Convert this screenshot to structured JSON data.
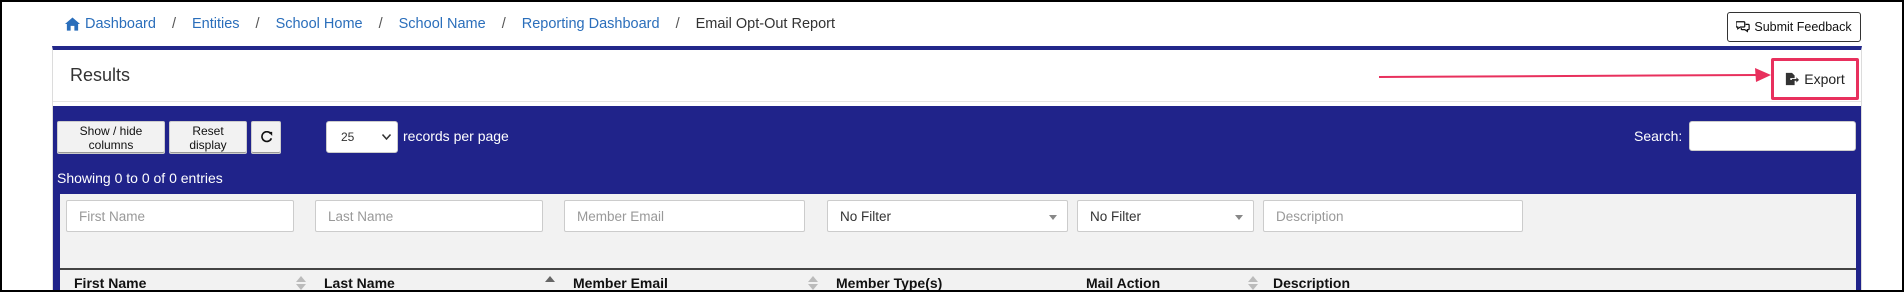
{
  "breadcrumb": {
    "items": [
      "Dashboard",
      "Entities",
      "School Home",
      "School Name",
      "Reporting Dashboard"
    ],
    "current": "Email Opt-Out Report",
    "separator": "/"
  },
  "feedback": {
    "label": "Submit Feedback"
  },
  "panel": {
    "title": "Results",
    "export_label": "Export"
  },
  "toolbar": {
    "show_hide": "Show / hide columns",
    "reset": "Reset display",
    "page_size": "25",
    "records_per_page": "records per page",
    "search_label": "Search:",
    "search_value": ""
  },
  "info": "Showing 0 to 0 of 0 entries",
  "filters": {
    "first_name": "First Name",
    "last_name": "Last Name",
    "member_email": "Member Email",
    "member_type": "No Filter",
    "mail_action": "No Filter",
    "description": "Description"
  },
  "columns": [
    "First Name",
    "Last Name",
    "Member Email",
    "Member Type(s)",
    "Mail Action",
    "Description"
  ],
  "colors": {
    "accent": "#22278a",
    "highlight": "#e8305d",
    "link": "#2a6ebb"
  },
  "icons": {
    "home": "home-icon",
    "feedback": "comments-icon",
    "export": "file-export-icon",
    "refresh": "refresh-icon"
  }
}
